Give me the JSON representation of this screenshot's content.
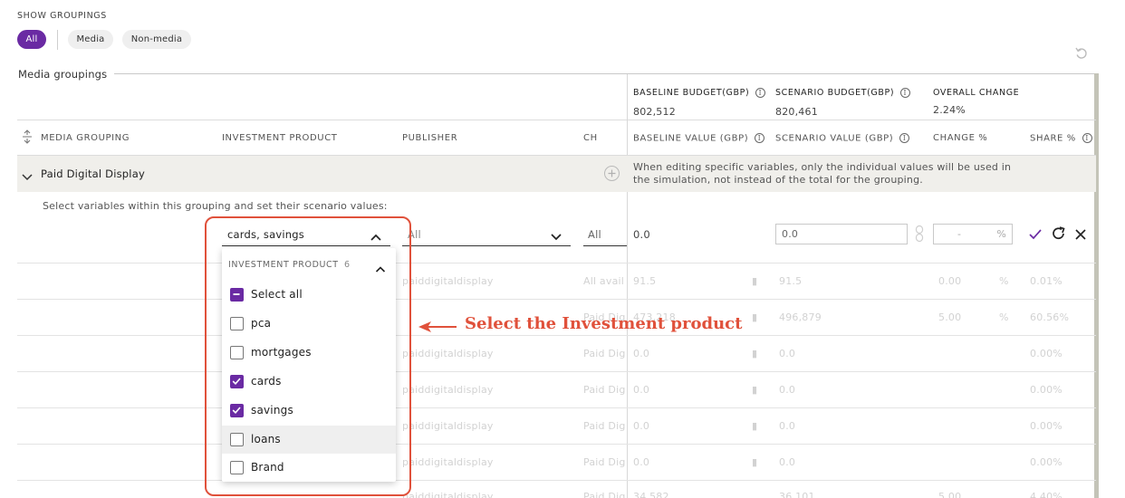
{
  "groupings": {
    "heading": "SHOW GROUPINGS",
    "filters": [
      {
        "label": "All",
        "active": true
      },
      {
        "label": "Media",
        "active": false
      },
      {
        "label": "Non-media",
        "active": false
      }
    ]
  },
  "section": {
    "title": "Media groupings"
  },
  "summary": {
    "baseline_label": "BASELINE BUDGET(GBP)",
    "baseline_value": "802,512",
    "scenario_label": "SCENARIO BUDGET(GBP)",
    "scenario_value": "820,461",
    "overall_label": "OVERALL CHANGE",
    "overall_value": "2.24%"
  },
  "table": {
    "columns": {
      "media_grouping": "MEDIA GROUPING",
      "investment_product": "INVESTMENT PRODUCT",
      "publisher": "PUBLISHER",
      "ch": "CH",
      "baseline_value": "BASELINE VALUE (GBP)",
      "scenario_value": "SCENARIO VALUE (GBP)",
      "change_pct": "CHANGE %",
      "share_pct": "SHARE %"
    },
    "group_name": "Paid Digital Display",
    "group_note": "When editing specific variables, only the individual values will be used in the simulation, not instead of the total for the grouping.",
    "instruction": "Select variables within this grouping and set their scenario values:",
    "edit_row": {
      "investment_value": "cards, savings",
      "publisher_value": "All",
      "channel_value": "All",
      "baseline": "0.0",
      "scenario_value": "0.0",
      "change_placeholder": "-",
      "pct_sign": "%"
    },
    "rows": [
      {
        "publisher": "paiddigitaldisplay",
        "channel": "All avail",
        "baseline": "91.5",
        "scenario": "91.5",
        "change": "0.00",
        "pct": "%",
        "share": "0.01%"
      },
      {
        "publisher": "",
        "channel": "Paid Dig",
        "baseline": "473,218",
        "scenario": "496,879",
        "change": "5.00",
        "pct": "%",
        "share": "60.56%"
      },
      {
        "publisher": "paiddigitaldisplay",
        "channel": "Paid Dig",
        "baseline": "0.0",
        "scenario": "0.0",
        "change": "",
        "pct": "",
        "share": "0.00%"
      },
      {
        "publisher": "paiddigitaldisplay",
        "channel": "Paid Dig",
        "baseline": "0.0",
        "scenario": "0.0",
        "change": "",
        "pct": "",
        "share": "0.00%"
      },
      {
        "publisher": "paiddigitaldisplay",
        "channel": "Paid Dig",
        "baseline": "0.0",
        "scenario": "0.0",
        "change": "",
        "pct": "",
        "share": "0.00%"
      },
      {
        "publisher": "paiddigitaldisplay",
        "channel": "Paid Dig",
        "baseline": "0.0",
        "scenario": "0.0",
        "change": "",
        "pct": "",
        "share": "0.00%"
      },
      {
        "publisher": "paiddigitaldisplay",
        "channel": "Paid Dig",
        "baseline": "34,582",
        "scenario": "36,101",
        "change": "5.00",
        "pct": "",
        "share": "4.40%"
      }
    ]
  },
  "dropdown": {
    "header": "INVESTMENT PRODUCT",
    "count": "6",
    "select_all": "Select all",
    "options": [
      {
        "label": "pca",
        "checked": false
      },
      {
        "label": "mortgages",
        "checked": false
      },
      {
        "label": "cards",
        "checked": true
      },
      {
        "label": "savings",
        "checked": true
      },
      {
        "label": "loans",
        "checked": false
      },
      {
        "label": "Brand",
        "checked": false
      }
    ]
  },
  "annotation": {
    "text": "Select the Investment product",
    "color": "#e0513b"
  },
  "colors": {
    "accent": "#6a2aa3",
    "annotation": "#e0513b"
  }
}
